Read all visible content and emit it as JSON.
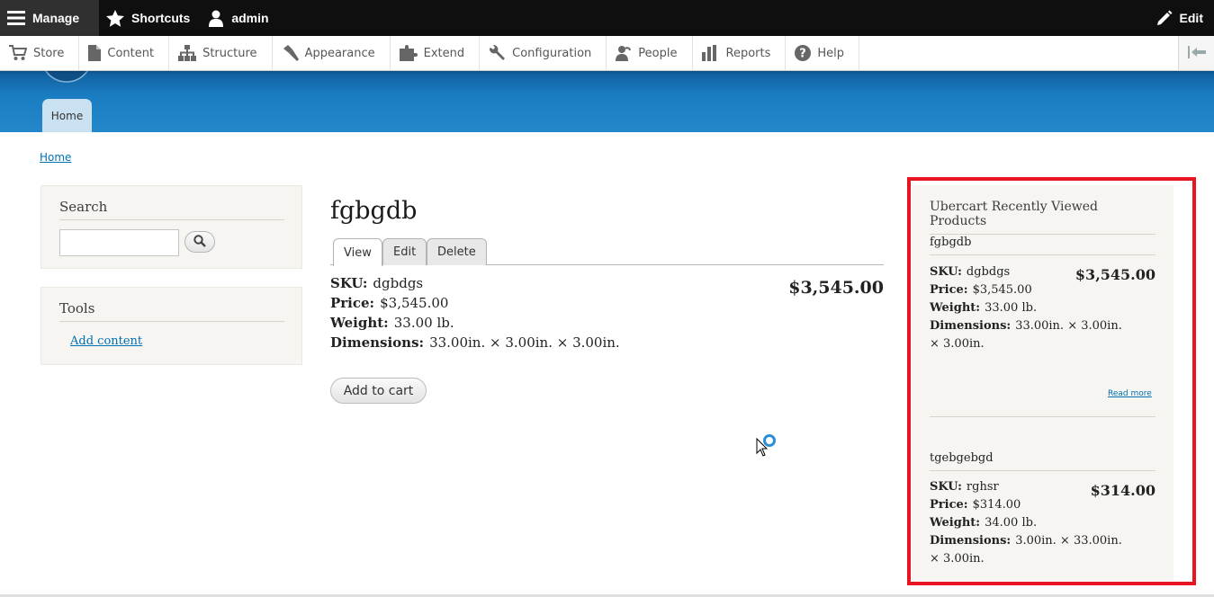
{
  "toolbar": {
    "manage": "Manage",
    "shortcuts": "Shortcuts",
    "user": "admin",
    "edit": "Edit"
  },
  "tray": {
    "items": [
      "Store",
      "Content",
      "Structure",
      "Appearance",
      "Extend",
      "Configuration",
      "People",
      "Reports",
      "Help"
    ]
  },
  "header": {
    "home_tab": "Home"
  },
  "breadcrumb": {
    "home": "Home"
  },
  "sidebar": {
    "search_title": "Search",
    "search_value": "",
    "tools_title": "Tools",
    "tools_link": "Add content"
  },
  "product": {
    "title": "fgbgdb",
    "tabs": [
      "View",
      "Edit",
      "Delete"
    ],
    "sku_label": "SKU:",
    "sku": "dgbdgs",
    "price_label": "Price:",
    "price": "$3,545.00",
    "weight_label": "Weight:",
    "weight": "33.00 lb.",
    "dimensions_label": "Dimensions:",
    "dimensions": "33.00in. × 3.00in. × 3.00in.",
    "display_price": "$3,545.00",
    "add_to_cart": "Add to cart"
  },
  "recently_viewed": {
    "title": "Ubercart Recently Viewed Products",
    "items": [
      {
        "name": "fgbgdb",
        "sku_label": "SKU:",
        "sku": "dgbdgs",
        "price_label": "Price:",
        "price": "$3,545.00",
        "weight_label": "Weight:",
        "weight": "33.00 lb.",
        "dimensions_label": "Dimensions:",
        "dimensions": "33.00in. × 3.00in. × 3.00in.",
        "display_price": "$3,545.00",
        "read_more": "Read more"
      },
      {
        "name": "tgebgebgd",
        "sku_label": "SKU:",
        "sku": "rghsr",
        "price_label": "Price:",
        "price": "$314.00",
        "weight_label": "Weight:",
        "weight": "34.00 lb.",
        "dimensions_label": "Dimensions:",
        "dimensions": "3.00in. × 33.00in. × 3.00in.",
        "display_price": "$314.00"
      }
    ]
  },
  "colors": {
    "header_blue": "#1a7dc1",
    "link_blue": "#0071b3",
    "highlight_red": "#e8141f",
    "toolbar_black": "#0f0f0f"
  }
}
